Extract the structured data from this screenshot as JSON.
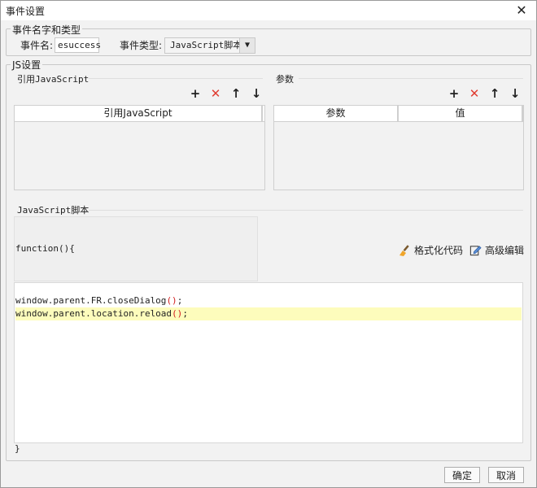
{
  "window": {
    "title": "事件设置"
  },
  "name_type_group": {
    "legend": "事件名字和类型",
    "name_label": "事件名:",
    "name_value": "esuccess",
    "type_label": "事件类型:",
    "type_value": "JavaScript脚本"
  },
  "js_group": {
    "legend": "JS设置",
    "ref_js": {
      "title": "引用JavaScript",
      "column": "引用JavaScript"
    },
    "params": {
      "title": "参数",
      "columns": [
        "参数",
        "值"
      ]
    },
    "toolbar_icons": [
      "add-icon",
      "delete-icon",
      "move-up-icon",
      "move-down-icon"
    ],
    "toolbar_glyphs": {
      "add": "+",
      "delete": "✕",
      "up": "↑",
      "down": "↓"
    },
    "script": {
      "title": "JavaScript脚本",
      "func_open": "function(){",
      "lines": [
        {
          "text": "window.parent.FR.closeDialog",
          "paren": "()",
          "end": ";"
        },
        {
          "text": "window.parent.location.reload",
          "paren": "()",
          "end": ";"
        }
      ],
      "func_close": "}",
      "format_label": "格式化代码",
      "advanced_label": "高级编辑"
    }
  },
  "footer": {
    "ok_label": "确定",
    "cancel_label": "取消"
  },
  "colors": {
    "delete": "#e03c31",
    "highlight": "#fdfcbc",
    "paren": "#d32020"
  }
}
